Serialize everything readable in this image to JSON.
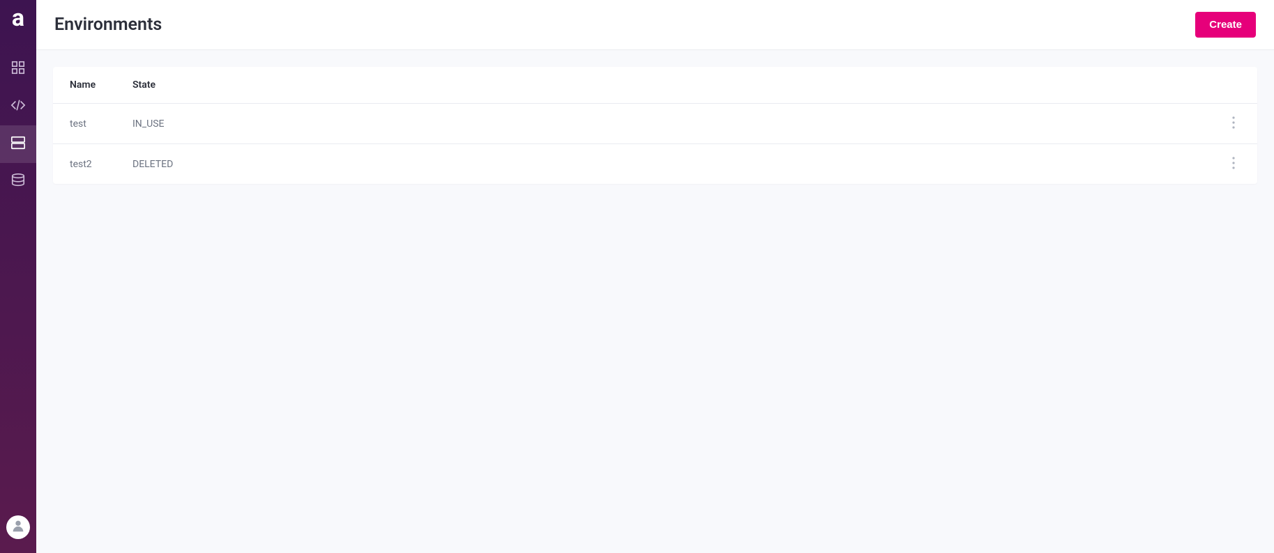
{
  "sidebar": {
    "logo_letter": "a"
  },
  "header": {
    "title": "Environments",
    "create_button_label": "Create"
  },
  "table": {
    "columns": {
      "name": "Name",
      "state": "State"
    },
    "rows": [
      {
        "name": "test",
        "state": "IN_USE"
      },
      {
        "name": "test2",
        "state": "DELETED"
      }
    ]
  }
}
